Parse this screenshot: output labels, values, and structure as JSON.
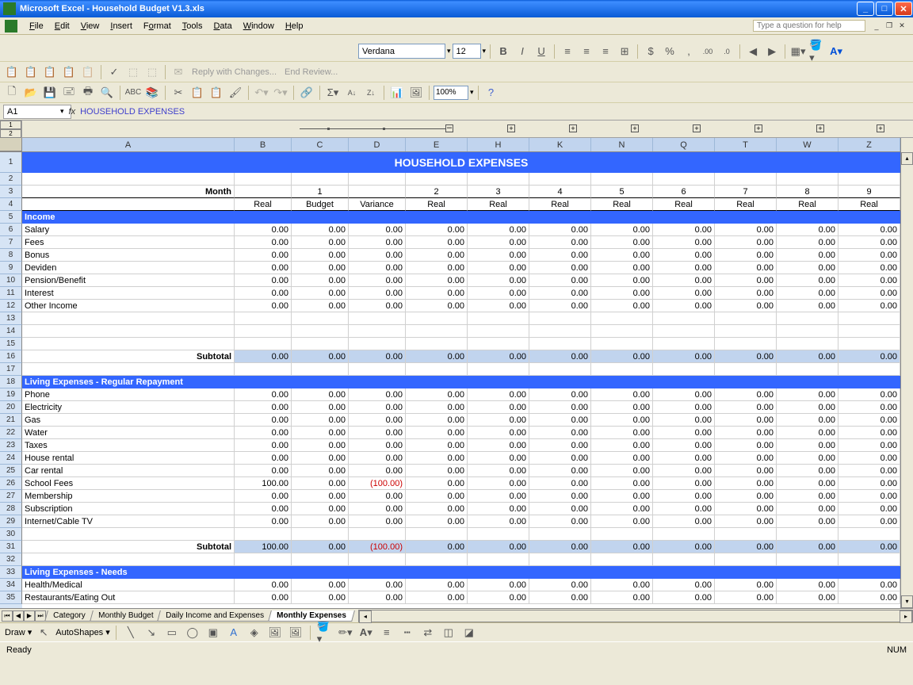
{
  "titlebar": {
    "text": "Microsoft Excel - Household Budget V1.3.xls"
  },
  "menus": [
    "File",
    "Edit",
    "View",
    "Insert",
    "Format",
    "Tools",
    "Data",
    "Window",
    "Help"
  ],
  "help_placeholder": "Type a question for help",
  "formatting": {
    "font": "Verdana",
    "size": "12"
  },
  "review_bar": {
    "reply": "Reply with Changes...",
    "end": "End Review..."
  },
  "zoom": "100%",
  "namebox": "A1",
  "formula": "HOUSEHOLD EXPENSES",
  "columns": [
    "A",
    "B",
    "C",
    "D",
    "E",
    "H",
    "K",
    "N",
    "Q",
    "T",
    "W",
    "Z"
  ],
  "title": "HOUSEHOLD EXPENSES",
  "month_label": "Month",
  "months": [
    "1",
    "2",
    "3",
    "4",
    "5",
    "6",
    "7",
    "8",
    "9"
  ],
  "sub_headers": [
    "Real",
    "Budget",
    "Variance",
    "Real",
    "Real",
    "Real",
    "Real",
    "Real",
    "Real",
    "Real",
    "Real"
  ],
  "sections": {
    "income": {
      "header": "Income",
      "rows": [
        "Salary",
        "Fees",
        "Bonus",
        "Deviden",
        "Pension/Benefit",
        "Interest",
        "Other Income"
      ],
      "subtotal_label": "Subtotal"
    },
    "regular": {
      "header": "Living Expenses - Regular Repayment",
      "rows": [
        "Phone",
        "Electricity",
        "Gas",
        "Water",
        "Taxes",
        "House rental",
        "Car rental",
        "School Fees",
        "Membership",
        "Subscription",
        "Internet/Cable TV"
      ],
      "subtotal_label": "Subtotal",
      "school_fees_real": "100.00",
      "school_fees_var": "(100.00)",
      "subtotal_real": "100.00",
      "subtotal_var": "(100.00)"
    },
    "needs": {
      "header": "Living Expenses - Needs",
      "rows": [
        "Health/Medical",
        "Restaurants/Eating Out"
      ]
    }
  },
  "zero": "0.00",
  "sheet_tabs": [
    "Category",
    "Monthly Budget",
    "Daily Income and Expenses",
    "Monthly Expenses"
  ],
  "active_tab": 3,
  "draw_label": "Draw",
  "autoshapes": "AutoShapes",
  "status": "Ready",
  "status_right": "NUM"
}
